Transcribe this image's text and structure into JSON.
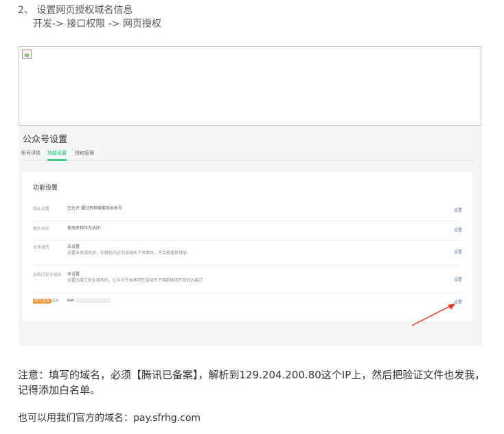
{
  "doc": {
    "step_title": "2、 设置网页授权域名信息",
    "step_path": "开发-> 接口权限 -> 网页授权",
    "note": "注意：填写的域名，必须【腾讯已备案】，解析到129.204.200.80这个IP上，然后把验证文件也发我，记得添加白名单。",
    "domain_line": "也可以用我们官方的域名：pay.sfrhg.com"
  },
  "screenshot": {
    "title": "公众号设置",
    "tabs": [
      "帐号详情",
      "功能设置",
      "授权管理"
    ],
    "active_tab": "功能设置",
    "card_title": "功能设置",
    "rows": [
      {
        "label": "隐私设置",
        "value": "已允许 通过名称搜索到本帐号",
        "desc": "",
        "action": "设置"
      },
      {
        "label": "图片水印",
        "value": "使用名称作为水印",
        "desc": "",
        "action": "设置"
      },
      {
        "label": "业务域名",
        "value": "未设置",
        "desc": "设置业务域名后，在微信内访问该域名下页面时，不会被重新排版。",
        "action": "设置"
      },
      {
        "label": "JS接口安全域名",
        "value": "未设置",
        "desc": "设置JS接口安全域名后，公众号开发者可在该域名下调用微信开放的JS接口",
        "action": "设置"
      },
      {
        "label_highlight": "网页授权",
        "label_rest": "域名",
        "value": "ww",
        "desc": "",
        "action": "设置"
      }
    ],
    "accent_color": "#07c160",
    "arrow_color": "#e8372b"
  }
}
